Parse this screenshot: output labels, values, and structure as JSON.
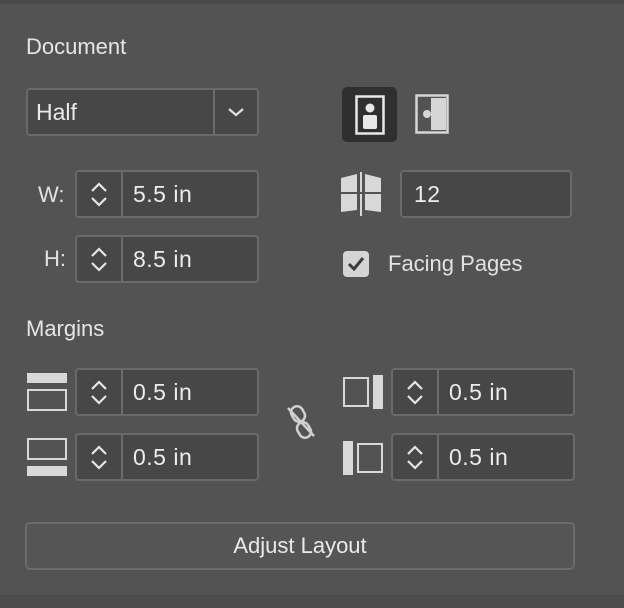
{
  "document": {
    "heading": "Document",
    "preset": "Half",
    "width_label": "W:",
    "width_value": "5.5 in",
    "height_label": "H:",
    "height_value": "8.5 in",
    "pages_value": "12",
    "facing_pages_label": "Facing Pages",
    "facing_pages_checked": true,
    "orientation": "portrait"
  },
  "margins": {
    "heading": "Margins",
    "top": "0.5 in",
    "bottom": "0.5 in",
    "inside": "0.5 in",
    "outside": "0.5 in",
    "linked": false
  },
  "actions": {
    "adjust_layout_label": "Adjust Layout"
  },
  "icons": {
    "dropdown": "chevron-down-icon",
    "portrait": "portrait-orientation-icon",
    "landscape": "landscape-orientation-icon",
    "pages": "facing-pages-icon",
    "link": "unlink-chain-icon",
    "top_margin": "top-margin-icon",
    "bottom_margin": "bottom-margin-icon",
    "inside_margin": "inside-margin-icon",
    "outside_margin": "outside-margin-icon"
  },
  "colors": {
    "panel_bg": "#535353",
    "field_bg": "#474747",
    "border": "#6a6a6a",
    "text": "#e8e8e8"
  }
}
